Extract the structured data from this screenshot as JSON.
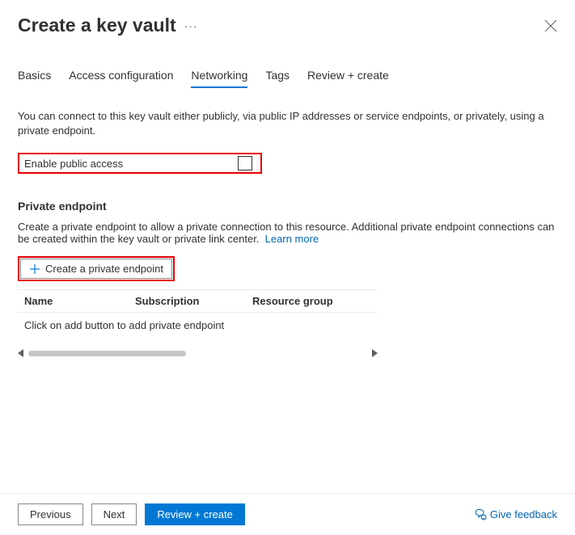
{
  "header": {
    "title": "Create a key vault"
  },
  "tabs": [
    {
      "label": "Basics",
      "active": false
    },
    {
      "label": "Access configuration",
      "active": false
    },
    {
      "label": "Networking",
      "active": true
    },
    {
      "label": "Tags",
      "active": false
    },
    {
      "label": "Review + create",
      "active": false
    }
  ],
  "networking": {
    "description": "You can connect to this key vault either publicly, via public IP addresses or service endpoints, or privately, using a private endpoint.",
    "publicAccess": {
      "label": "Enable public access",
      "checked": false
    },
    "privateEndpoint": {
      "title": "Private endpoint",
      "description": "Create a private endpoint to allow a private connection to this resource. Additional private endpoint connections can be created within the key vault or private link center.",
      "learnMore": "Learn more",
      "createButton": "Create a private endpoint",
      "columns": {
        "name": "Name",
        "subscription": "Subscription",
        "resourceGroup": "Resource group"
      },
      "emptyMessage": "Click on add button to add private endpoint"
    }
  },
  "footer": {
    "previous": "Previous",
    "next": "Next",
    "reviewCreate": "Review + create",
    "feedback": "Give feedback"
  }
}
